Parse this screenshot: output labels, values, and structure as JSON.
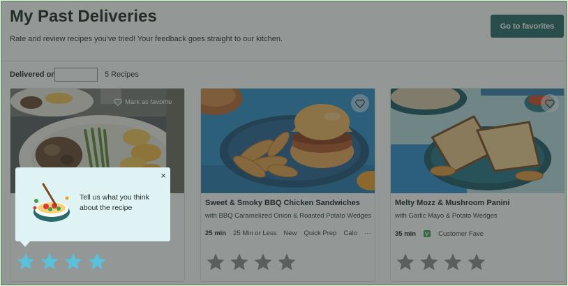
{
  "header": {
    "title": "My Past Deliveries",
    "subtitle": "Rate and review recipes you've tried! Your feedback goes straight to our kitchen.",
    "favorites_button": "Go to favorites"
  },
  "filter": {
    "label": "Delivered on",
    "input_value": "",
    "recipe_count": "5 Recipes"
  },
  "cards": [
    {
      "mark_favorite": "Mark as favorite",
      "rating": 4
    },
    {
      "title": "Sweet & Smoky BBQ Chicken Sandwiches",
      "subtitle": "with BBQ Caramelized Onion & Roasted Potato Wedges",
      "time": "25 min",
      "tags": [
        "25 Min or Less",
        "New",
        "Quick Prep",
        "Calo"
      ],
      "more": "···",
      "rating": 0
    },
    {
      "title": "Melty Mozz & Mushroom Panini",
      "subtitle": "with Garlic Mayo & Potato Wedges",
      "time": "35 min",
      "tags": [
        "Customer Fave"
      ],
      "rating": 0
    }
  ],
  "popup": {
    "text": "Tell us what you think about the recipe",
    "close": "×"
  },
  "icons": {
    "heart": "heart-icon",
    "close": "close-icon",
    "star": "star-icon",
    "badge": "customer-fave-icon"
  },
  "colors": {
    "accent": "#2a6a6a",
    "star_active": "#5bc0dc",
    "star_empty": "#8a8f8c",
    "popup_bg": "#dff2f4",
    "badge_green": "#3aa04a"
  }
}
